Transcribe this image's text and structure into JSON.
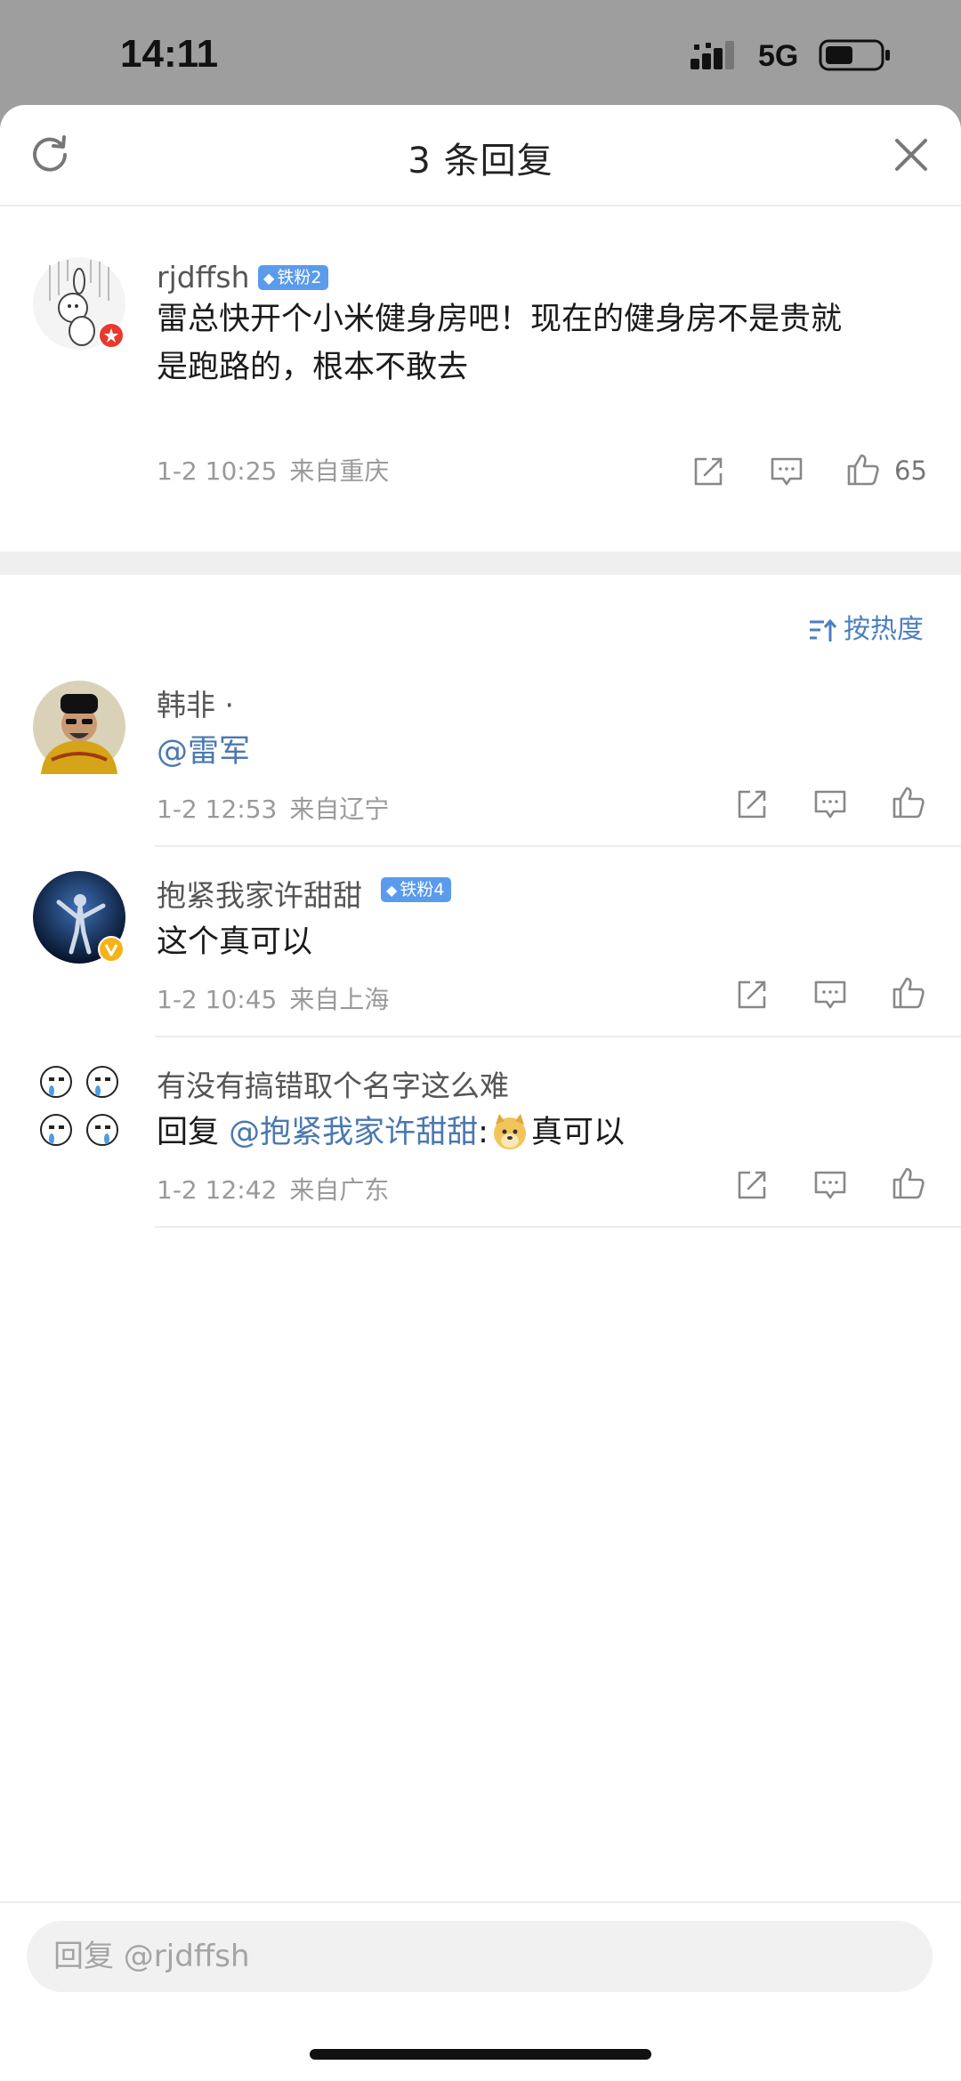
{
  "status_bar": {
    "time": "14:11",
    "network": "5G"
  },
  "sheet": {
    "title": "3 条回复"
  },
  "root_comment": {
    "username": "rjdffsh",
    "badge": "铁粉2",
    "text_line1": "雷总快开个小米健身房吧！现在的健身房不是贵就",
    "text_line2": "是跑路的，根本不敢去",
    "date": "1-2 10:25",
    "location": "来自重庆",
    "likes": "65"
  },
  "sort_label": "按热度",
  "replies": [
    {
      "username": "韩非 ·",
      "text": "@雷军",
      "date": "1-2 12:53",
      "location": "来自辽宁"
    },
    {
      "username": "抱紧我家许甜甜",
      "badge": "铁粉4",
      "text": "这个真可以",
      "date": "1-2 10:45",
      "location": "来自上海"
    },
    {
      "username": "有没有搞错取个名字这么难",
      "text_prefix": "回复 ",
      "mention": "@抱紧我家许甜甜",
      "colon": ":",
      "text_suffix": "真可以",
      "date": "1-2 12:42",
      "location": "来自广东"
    }
  ],
  "reply_input": {
    "placeholder": "回复 @rjdffsh"
  },
  "colors": {
    "accent": "#4a7fc0",
    "badge": "#5a9bec",
    "mention": "#4a78b0"
  }
}
